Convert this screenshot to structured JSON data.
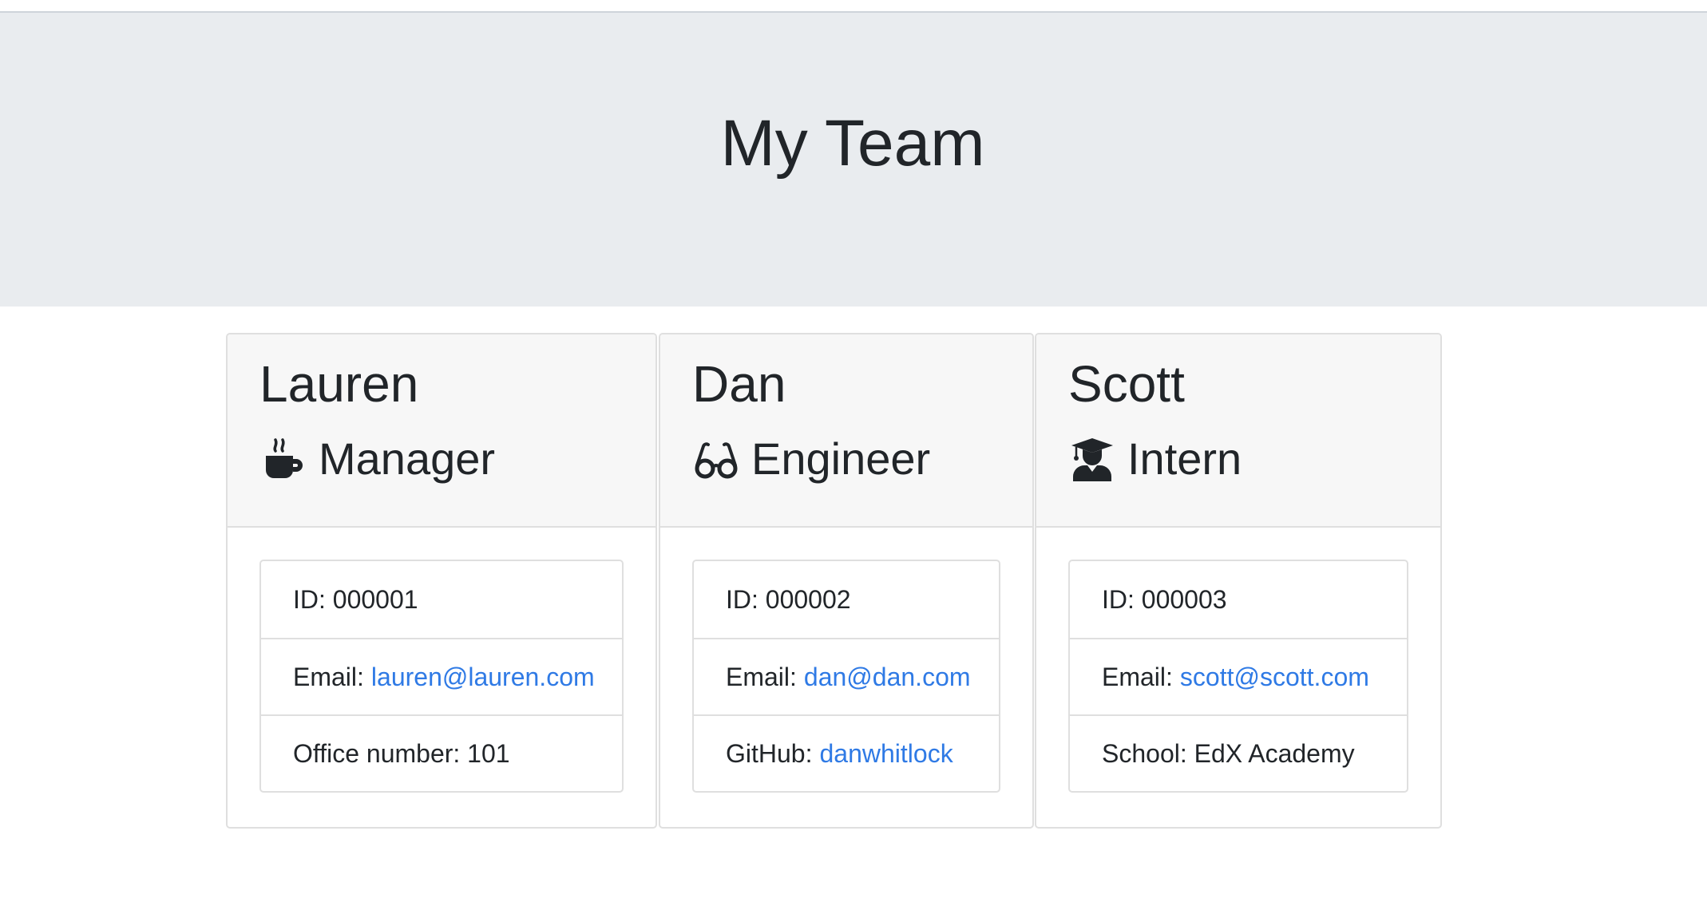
{
  "page": {
    "title": "My Team"
  },
  "colors": {
    "jumbotron_bg": "#e9ecef",
    "card_header_bg": "#f7f7f7",
    "link": "#2f7ae5",
    "text": "#212529",
    "border": "#dfdfdf"
  },
  "team": [
    {
      "name": "Lauren",
      "role": "Manager",
      "icon": "coffee-mug-icon",
      "id_label": "ID:",
      "id_value": "000001",
      "email_label": "Email:",
      "email": "lauren@lauren.com",
      "extra_label": "Office number:",
      "extra_value": "101"
    },
    {
      "name": "Dan",
      "role": "Engineer",
      "icon": "glasses-icon",
      "id_label": "ID:",
      "id_value": "000002",
      "email_label": "Email:",
      "email": "dan@dan.com",
      "extra_label": "GitHub:",
      "extra_value": "danwhitlock"
    },
    {
      "name": "Scott",
      "role": "Intern",
      "icon": "graduate-icon",
      "id_label": "ID:",
      "id_value": "000003",
      "email_label": "Email:",
      "email": "scott@scott.com",
      "extra_label": "School:",
      "extra_value": "EdX Academy"
    }
  ]
}
